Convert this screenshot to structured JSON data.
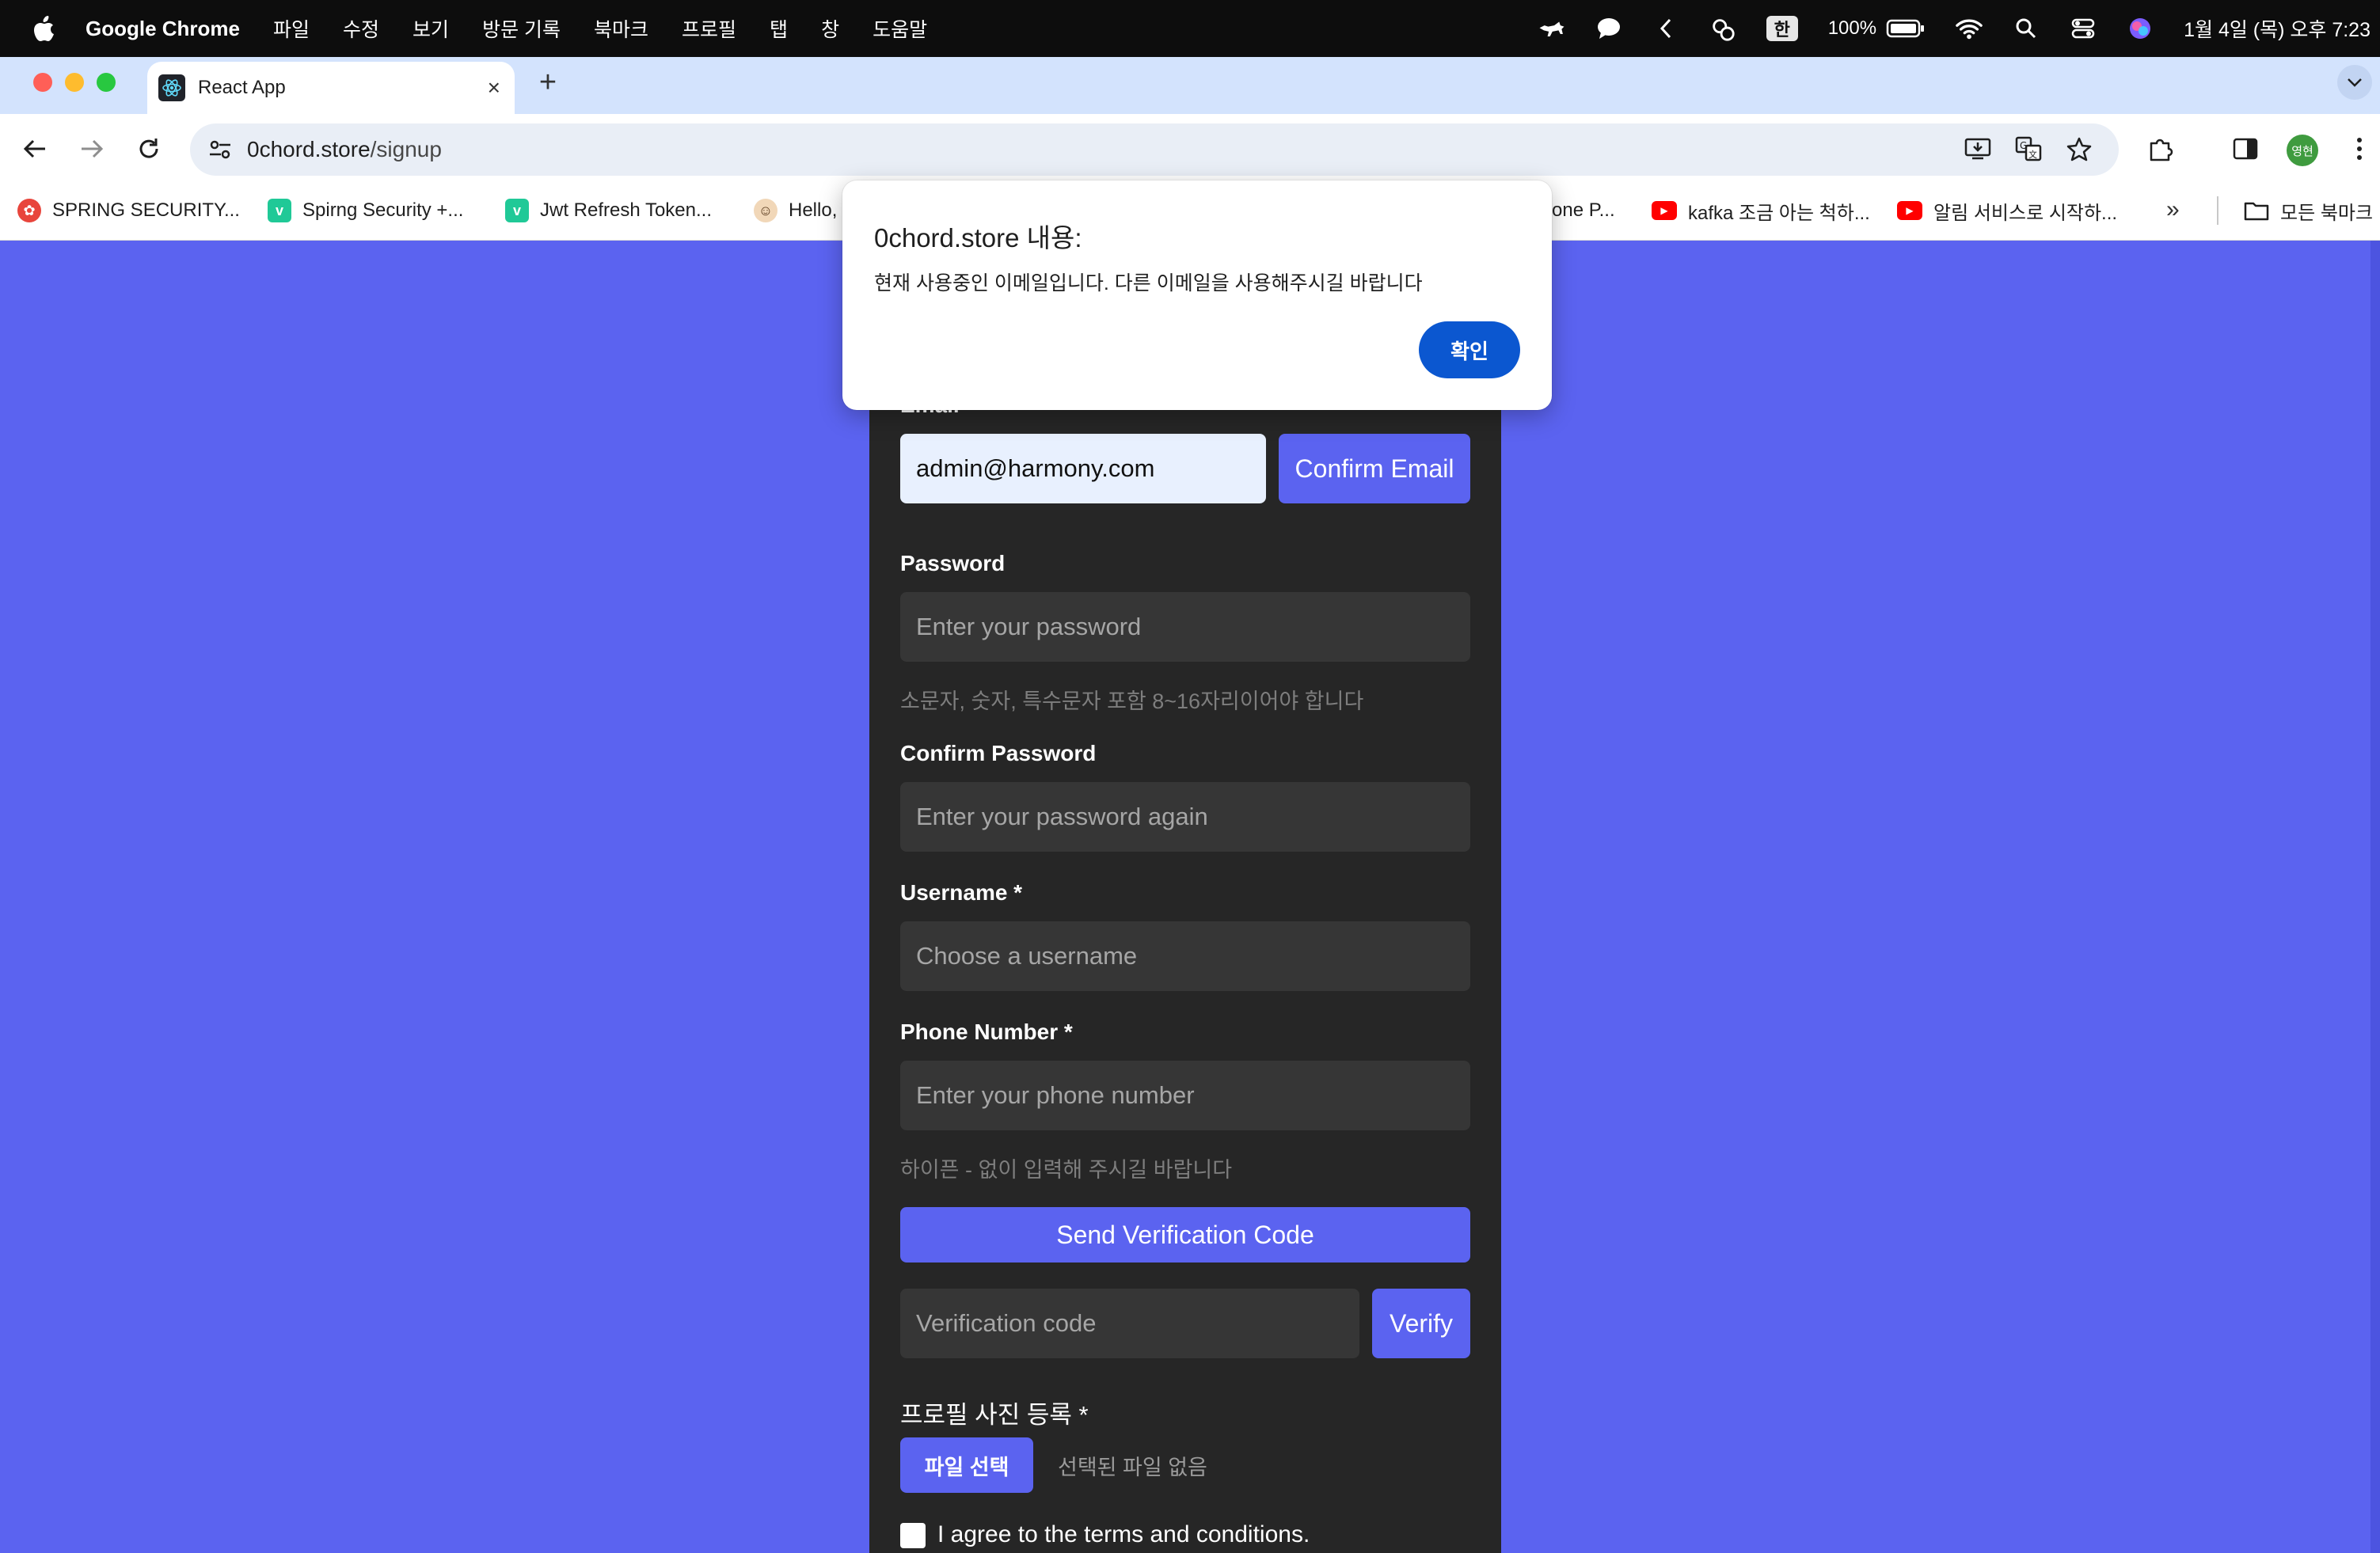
{
  "menubar": {
    "app_name": "Google Chrome",
    "items": [
      "파일",
      "수정",
      "보기",
      "방문 기록",
      "북마크",
      "프로필",
      "탭",
      "창",
      "도움말"
    ],
    "ime": "한",
    "battery": "100%",
    "clock": "1월 4일 (목) 오후 7:23"
  },
  "tab": {
    "title": "React App",
    "close": "×",
    "new": "+"
  },
  "omnibox": {
    "host": "0chord.store",
    "path": "/signup"
  },
  "profile": {
    "avatar_text": "영현"
  },
  "bookmarks": {
    "items": [
      {
        "label": "SPRING SECURITY...",
        "icon": "spring-icon",
        "color": "#e8453c"
      },
      {
        "label": "Spirng Security +...",
        "icon": "velog-icon",
        "color": "#20c997"
      },
      {
        "label": "Jwt Refresh Token...",
        "icon": "velog-icon",
        "color": "#20c997"
      },
      {
        "label": "Hello,",
        "icon": "person-icon",
        "color": "#c79a6b"
      },
      {
        "label": "one P...",
        "icon": "",
        "color": ""
      },
      {
        "label": "kafka 조금 아는 척하...",
        "icon": "youtube-icon",
        "color": "#ff0000"
      },
      {
        "label": "알림 서비스로 시작하...",
        "icon": "youtube-icon",
        "color": "#ff0000"
      }
    ],
    "more": "»",
    "all_bookmarks": "모든 북마크"
  },
  "form": {
    "email_label": "Email",
    "email_value": "admin@harmony.com",
    "confirm_email": "Confirm Email",
    "password_label": "Password",
    "password_placeholder": "Enter your password",
    "password_hint": "소문자, 숫자, 특수문자 포함 8~16자리이어야 합니다",
    "confirm_password_label": "Confirm Password",
    "confirm_password_placeholder": "Enter your password again",
    "username_label": "Username *",
    "username_placeholder": "Choose a username",
    "phone_label": "Phone Number *",
    "phone_placeholder": "Enter your phone number",
    "phone_hint": "하이픈 - 없이 입력해 주시길 바랍니다",
    "send_code": "Send Verification Code",
    "code_placeholder": "Verification code",
    "verify": "Verify",
    "photo_label": "프로필 사진 등록 *",
    "file_button": "파일 선택",
    "file_none": "선택된 파일 없음",
    "agree": "I agree to the terms and conditions."
  },
  "dialog": {
    "title": "0chord.store 내용:",
    "message": "현재 사용중인 이메일입니다. 다른 이메일을 사용해주시길 바랍니다",
    "ok": "확인"
  },
  "colors": {
    "page_bg": "#5b63f0",
    "card_bg": "#262626",
    "accent": "#5b63f0",
    "dialog_button": "#0b57d0"
  }
}
